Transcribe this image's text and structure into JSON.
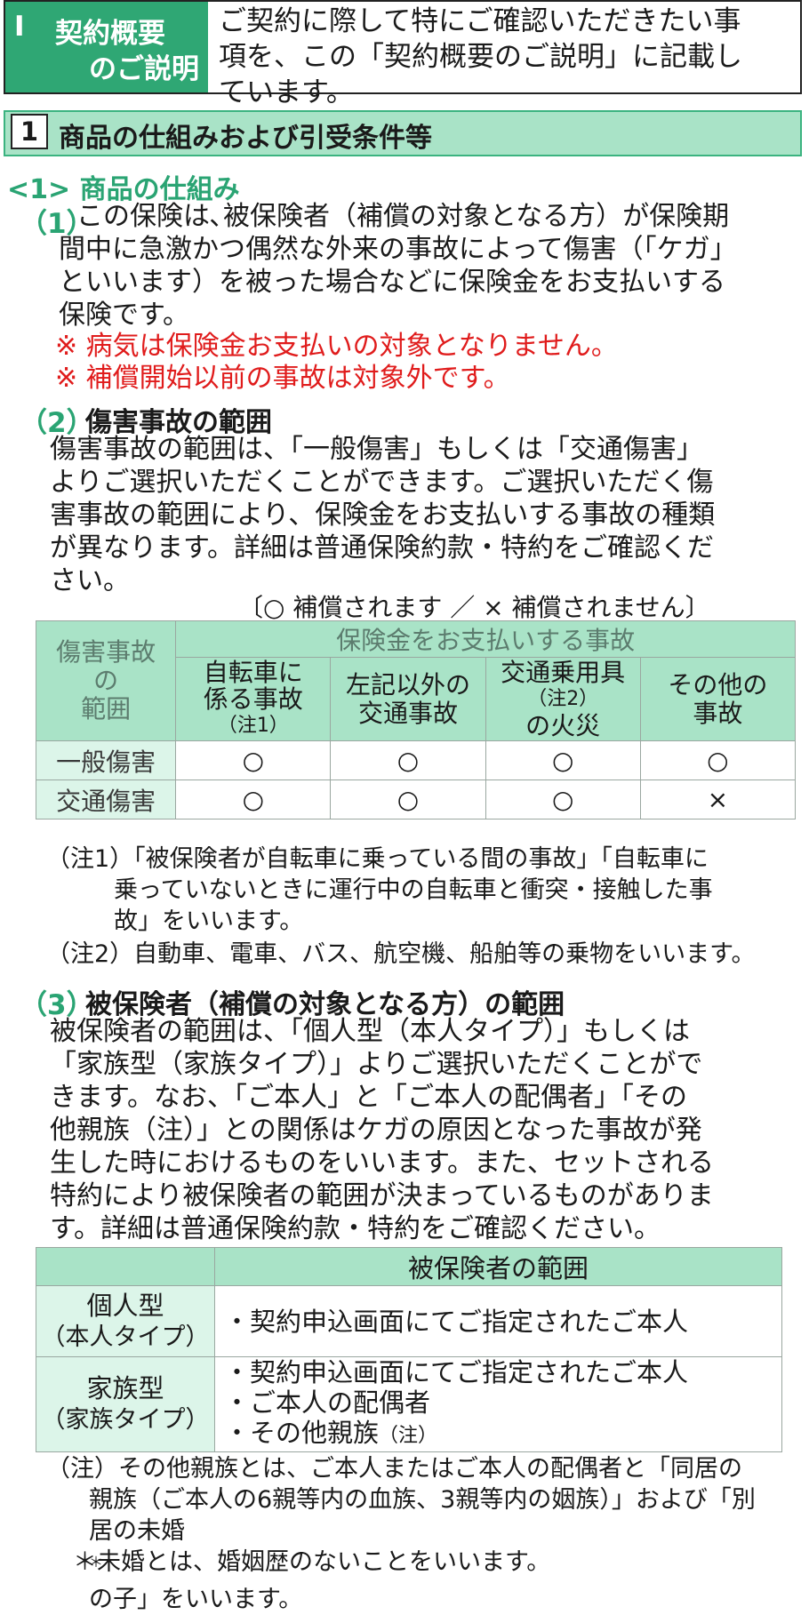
{
  "header": {
    "label_num": "Ⅰ",
    "label_line1": "契約概要",
    "label_line2": "のご説明",
    "intro_lines": [
      "ご契約に際して特にご確認いただきたい事",
      "項を、この「契約概要のご説明」に記載し",
      "ています。"
    ]
  },
  "section": {
    "num": "1",
    "title": "商品の仕組みおよび引受条件等"
  },
  "sub1": {
    "label": "<1> 商品の仕組み"
  },
  "item1": {
    "num": "（1）",
    "lines": [
      "この保険は､被保険者（補償の対象となる方）が保険期",
      "間中に急激かつ偶然な外来の事故によって傷害（｢ケガ｣",
      "といいます）を被った場合などに保険金をお支払いする",
      "保険です。"
    ],
    "red_notes": [
      "※ 病気は保険金お支払いの対象となりません。",
      "※ 補償開始以前の事故は対象外です。"
    ]
  },
  "item2": {
    "num": "（2）",
    "title": "傷害事故の範囲",
    "lines": [
      "傷害事故の範囲は、「一般傷害」もしくは「交通傷害」",
      "よりご選択いただくことができます。ご選択いただく傷",
      "害事故の範囲により、保険金をお支払いする事故の種類",
      "が異なります。詳細は普通保険約款・特約をご確認くだ",
      "さい。"
    ],
    "legend": "〔○ 補償されます ／ × 補償されません〕"
  },
  "table1": {
    "corner": [
      "傷害事故",
      "の",
      "範囲"
    ],
    "group_header": "保険金をお支払いする事故",
    "col1": {
      "line1": "自転車に",
      "line2": "係る事故",
      "note": "（注1）"
    },
    "col2": {
      "line1": "左記以外の",
      "line2": "交通事故"
    },
    "col3": {
      "line1": "交通乗用具",
      "note": "（注2）",
      "line2": "の火災"
    },
    "col4": {
      "line1": "その他の",
      "line2": "事故"
    },
    "rows": [
      {
        "name": "一般傷害",
        "c1": "○",
        "c2": "○",
        "c3": "○",
        "c4": "○"
      },
      {
        "name": "交通傷害",
        "c1": "○",
        "c2": "○",
        "c3": "○",
        "c4": "×"
      }
    ]
  },
  "notes1": {
    "n1_lines": [
      "（注1）「被保険者が自転車に乗っている間の事故」「自転車に",
      "乗っていないときに運行中の自転車と衝突・接触した事",
      "故」をいいます。"
    ],
    "n2": "（注2）自動車、電車、バス、航空機、船舶等の乗物をいいます。"
  },
  "item3": {
    "num": "（3）",
    "title": "被保険者（補償の対象となる方）の範囲",
    "lines": [
      "被保険者の範囲は、「個人型（本人タイプ）」もしくは",
      "「家族型（家族タイプ）」よりご選択いただくことがで",
      "きます。なお、「ご本人」と「ご本人の配偶者」「その",
      "他親族（注）」との関係はケガの原因となった事故が発",
      "生した時におけるものをいいます。また、セットされる",
      "特約により被保険者の範囲が決まっているものがありま",
      "す。詳細は普通保険約款・特約をご確認ください。"
    ]
  },
  "table2": {
    "header": "被保険者の範囲",
    "rows": [
      {
        "name": "個人型",
        "sub": "（本人タイプ）",
        "items": [
          "・契約申込画面にてご指定されたご本人"
        ]
      },
      {
        "name": "家族型",
        "sub": "（家族タイプ）",
        "items": [
          "・契約申込画面にてご指定されたご本人",
          "・ご本人の配偶者",
          "・その他親族"
        ],
        "last_note": "（注）"
      }
    ]
  },
  "notes2": {
    "lines": [
      "（注）その他親族とは、ご本人またはご本人の配偶者と「同居の",
      "親族（ご本人の6親等内の血族、3親等内の姻族）」および「別"
    ],
    "line3_pre": "居の未婚",
    "line3_sup": "＊",
    "line3_post": "の子」をいいます。",
    "footnote": "＊未婚とは、婚姻歴のないことをいいます。"
  }
}
